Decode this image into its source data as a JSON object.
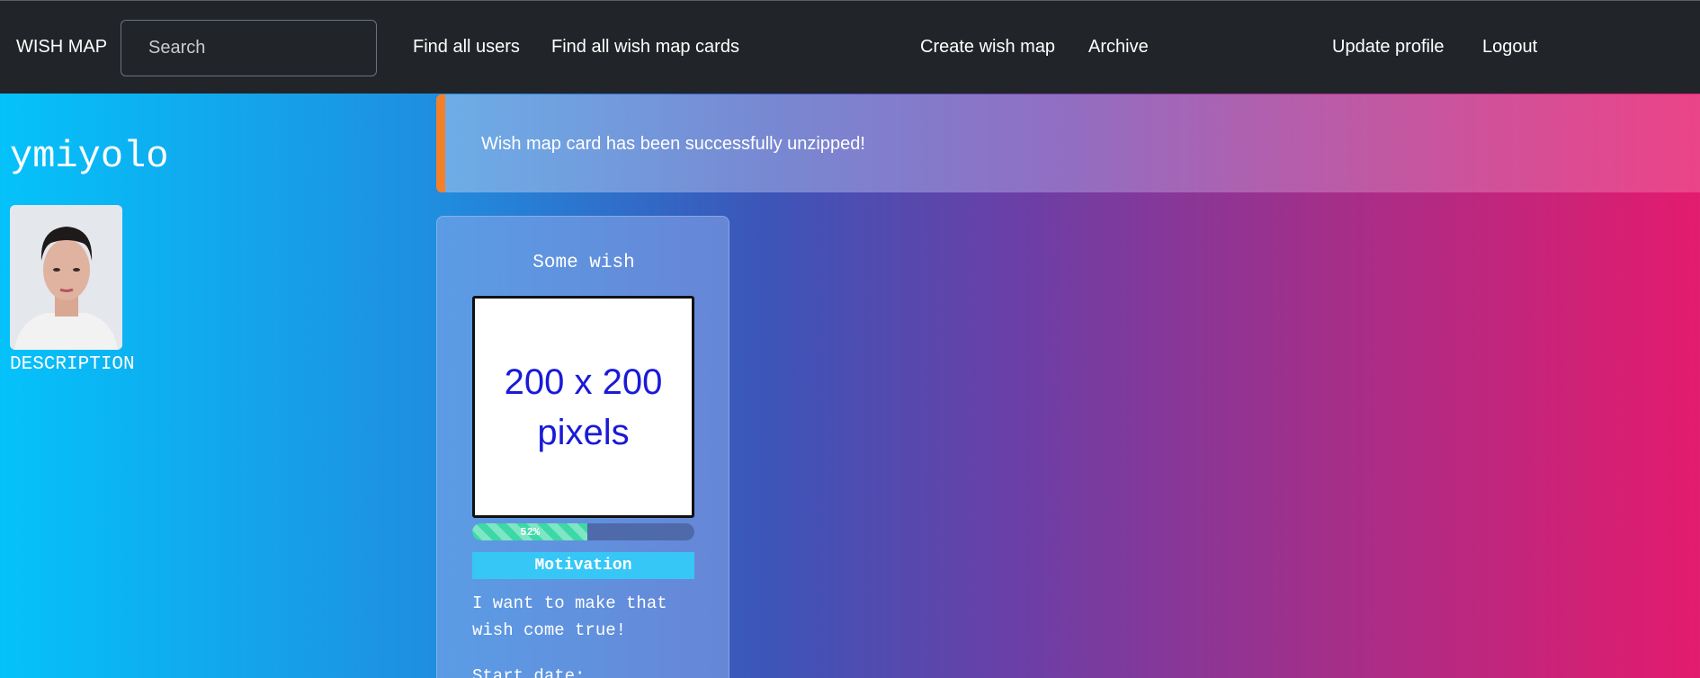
{
  "navbar": {
    "brand": "WISH MAP",
    "search_placeholder": "Search",
    "links": {
      "find_users": "Find all users",
      "find_cards": "Find all wish map cards",
      "create": "Create wish map",
      "archive": "Archive",
      "update_profile": "Update profile",
      "logout": "Logout"
    }
  },
  "alert": {
    "message": "Wish map card has been successfully unzipped!",
    "accent_color": "#f5802a"
  },
  "profile": {
    "username": "ymiyolo",
    "description_label": "DESCRIPTION"
  },
  "card": {
    "title": "Some wish",
    "image_text": "200 x 200\npixels",
    "progress_label": "52%",
    "progress_value": 0.52,
    "motivation_label": "Motivation",
    "motivation_text": "I want to make that wish come true!",
    "start_date_label": "Start date:"
  }
}
